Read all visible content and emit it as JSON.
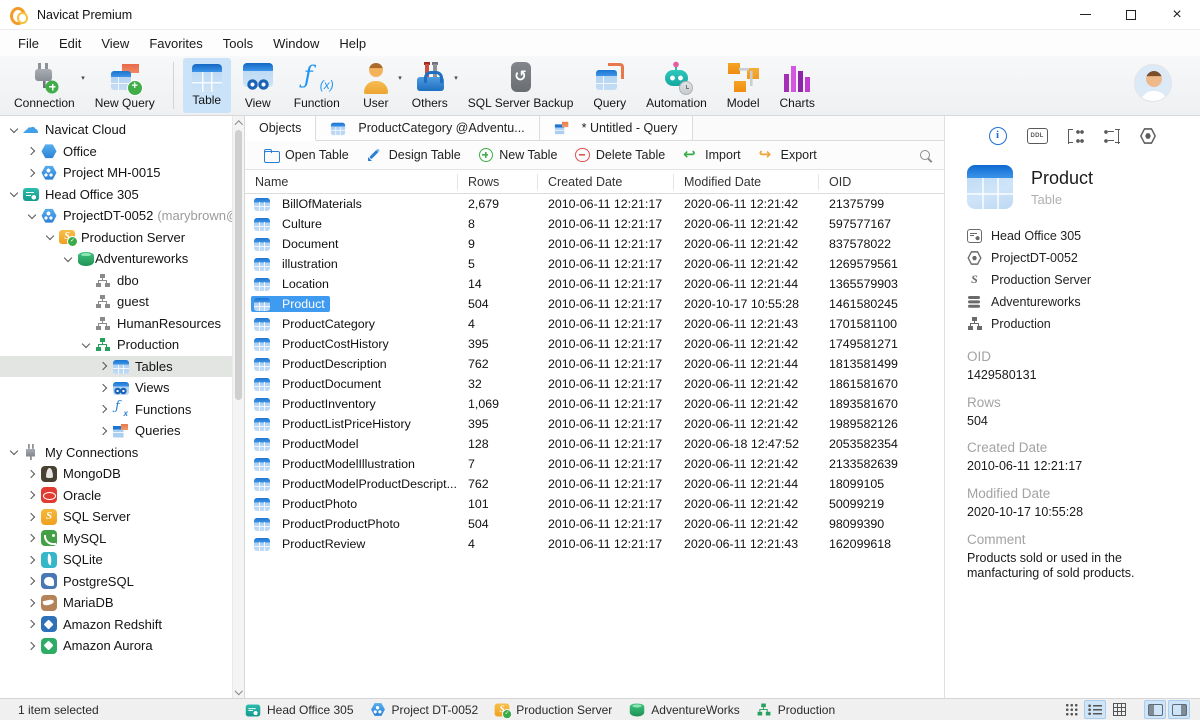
{
  "titlebar": {
    "title": "Navicat Premium",
    "controls": [
      "minimize",
      "maximize",
      "close"
    ]
  },
  "menubar": {
    "items": [
      "File",
      "Edit",
      "View",
      "Favorites",
      "Tools",
      "Window",
      "Help"
    ]
  },
  "toolbar": {
    "buttons": [
      {
        "label": "Connection",
        "icon": "connection",
        "dropdown": true,
        "divider_after": false
      },
      {
        "label": "New Query",
        "icon": "newquery",
        "divider_after": true
      },
      {
        "label": "Table",
        "icon": "table",
        "selected": true
      },
      {
        "label": "View",
        "icon": "view"
      },
      {
        "label": "Function",
        "icon": "function"
      },
      {
        "label": "User",
        "icon": "user",
        "dropdown": true
      },
      {
        "label": "Others",
        "icon": "others",
        "dropdown": true
      },
      {
        "label": "SQL Server Backup",
        "icon": "backup"
      },
      {
        "label": "Query",
        "icon": "query"
      },
      {
        "label": "Automation",
        "icon": "automation"
      },
      {
        "label": "Model",
        "icon": "model"
      },
      {
        "label": "Charts",
        "icon": "charts"
      }
    ]
  },
  "sidebar": {
    "items": [
      {
        "label": "Navicat Cloud",
        "level": 0,
        "chevron": "down",
        "icon": "cloud"
      },
      {
        "label": "Office",
        "level": 1,
        "chevron": "right",
        "icon": "hex"
      },
      {
        "label": "Project MH-0015",
        "level": 1,
        "chevron": "right",
        "icon": "proj"
      },
      {
        "label": "Head Office 305",
        "level": 0,
        "chevron": "down",
        "icon": "ws"
      },
      {
        "label": "ProjectDT-0052",
        "suffix": "(marybrown@",
        "level": 1,
        "chevron": "down",
        "icon": "proj"
      },
      {
        "label": "Production Server",
        "level": 2,
        "chevron": "down",
        "icon": "srv"
      },
      {
        "label": "Adventureworks",
        "level": 3,
        "chevron": "down",
        "icon": "db"
      },
      {
        "label": "dbo",
        "level": 4,
        "chevron": null,
        "icon": "orgg"
      },
      {
        "label": "guest",
        "level": 4,
        "chevron": null,
        "icon": "orgg"
      },
      {
        "label": "HumanResources",
        "level": 4,
        "chevron": null,
        "icon": "orgg"
      },
      {
        "label": "Production",
        "level": 4,
        "chevron": "down",
        "icon": "orggr"
      },
      {
        "label": "Tables",
        "level": 5,
        "chevron": "right",
        "icon": "tbl",
        "selected": true
      },
      {
        "label": "Views",
        "level": 5,
        "chevron": "right",
        "icon": "view"
      },
      {
        "label": "Functions",
        "level": 5,
        "chevron": "right",
        "icon": "fx"
      },
      {
        "label": "Queries",
        "level": 5,
        "chevron": "right",
        "icon": "qry"
      },
      {
        "label": "My Connections",
        "level": 0,
        "chevron": "down",
        "icon": "plug"
      },
      {
        "label": "MongoDB",
        "level": 1,
        "chevron": "right",
        "icon": "mongodb"
      },
      {
        "label": "Oracle",
        "level": 1,
        "chevron": "right",
        "icon": "oracle"
      },
      {
        "label": "SQL Server",
        "level": 1,
        "chevron": "right",
        "icon": "sqlserver"
      },
      {
        "label": "MySQL",
        "level": 1,
        "chevron": "right",
        "icon": "mysql"
      },
      {
        "label": "SQLite",
        "level": 1,
        "chevron": "right",
        "icon": "sqlite"
      },
      {
        "label": "PostgreSQL",
        "level": 1,
        "chevron": "right",
        "icon": "postgresql"
      },
      {
        "label": "MariaDB",
        "level": 1,
        "chevron": "right",
        "icon": "mariadb"
      },
      {
        "label": "Amazon Redshift",
        "level": 1,
        "chevron": "right",
        "icon": "redshift"
      },
      {
        "label": "Amazon Aurora",
        "level": 1,
        "chevron": "right",
        "icon": "aurora"
      }
    ]
  },
  "tabs": [
    {
      "label": "Objects",
      "icon": null,
      "active": true
    },
    {
      "label": "ProductCategory @Adventu...",
      "icon": "tbl"
    },
    {
      "label": "* Untitled - Query",
      "icon": "qry"
    }
  ],
  "object_toolbar": {
    "buttons": [
      {
        "label": "Open Table",
        "icon": "open"
      },
      {
        "label": "Design Table",
        "icon": "design"
      },
      {
        "label": "New Table",
        "icon": "plus"
      },
      {
        "label": "Delete Table",
        "icon": "minus"
      },
      {
        "label": "Import",
        "icon": "import"
      },
      {
        "label": "Export",
        "icon": "export"
      }
    ]
  },
  "objects_table": {
    "columns": [
      "Name",
      "Rows",
      "Created Date",
      "Modified Date",
      "OID"
    ],
    "selected_row": "Product",
    "rows": [
      [
        "BillOfMaterials",
        "2,679",
        "2010-06-11 12:21:17",
        "2020-06-11 12:21:42",
        "21375799"
      ],
      [
        "Culture",
        "8",
        "2010-06-11 12:21:17",
        "2020-06-11 12:21:42",
        "597577167"
      ],
      [
        "Document",
        "9",
        "2010-06-11 12:21:17",
        "2020-06-11 12:21:42",
        "837578022"
      ],
      [
        "illustration",
        "5",
        "2010-06-11 12:21:17",
        "2020-06-11 12:21:42",
        "1269579561"
      ],
      [
        "Location",
        "14",
        "2010-06-11 12:21:17",
        "2020-06-11 12:21:44",
        "1365579903"
      ],
      [
        "Product",
        "504",
        "2010-06-11 12:21:17",
        "2020-10-17 10:55:28",
        "1461580245"
      ],
      [
        "ProductCategory",
        "4",
        "2010-06-11 12:21:17",
        "2020-06-11 12:21:43",
        "1701581100"
      ],
      [
        "ProductCostHistory",
        "395",
        "2010-06-11 12:21:17",
        "2020-06-11 12:21:42",
        "1749581271"
      ],
      [
        "ProductDescription",
        "762",
        "2010-06-11 12:21:17",
        "2020-06-11 12:21:44",
        "1813581499"
      ],
      [
        "ProductDocument",
        "32",
        "2010-06-11 12:21:17",
        "2020-06-11 12:21:42",
        "1861581670"
      ],
      [
        "ProductInventory",
        "1,069",
        "2010-06-11 12:21:17",
        "2020-06-11 12:21:42",
        "1893581670"
      ],
      [
        "ProductListPriceHistory",
        "395",
        "2010-06-11 12:21:17",
        "2020-06-11 12:21:42",
        "1989582126"
      ],
      [
        "ProductModel",
        "128",
        "2010-06-11 12:21:17",
        "2020-06-18 12:47:52",
        "2053582354"
      ],
      [
        "ProductModelIllustration",
        "7",
        "2010-06-11 12:21:17",
        "2020-06-11 12:21:42",
        "2133582639"
      ],
      [
        "ProductModelProductDescript...",
        "762",
        "2010-06-11 12:21:17",
        "2020-06-11 12:21:44",
        "18099105"
      ],
      [
        "ProductPhoto",
        "101",
        "2010-06-11 12:21:17",
        "2020-06-11 12:21:42",
        "50099219"
      ],
      [
        "ProductProductPhoto",
        "504",
        "2010-06-11 12:21:17",
        "2020-06-11 12:21:42",
        "98099390"
      ],
      [
        "ProductReview",
        "4",
        "2010-06-11 12:21:17",
        "2020-06-11 12:21:43",
        "162099618"
      ]
    ]
  },
  "right_panel": {
    "icons": [
      {
        "name": "info",
        "active": true
      },
      {
        "name": "ddl",
        "active": false
      },
      {
        "name": "rel1",
        "active": false
      },
      {
        "name": "rel2",
        "active": false
      },
      {
        "name": "hexx",
        "active": false
      }
    ],
    "title": "Product",
    "subtitle": "Table",
    "crumbs": [
      {
        "label": "Head Office 305",
        "icon": "ws"
      },
      {
        "label": "ProjectDT-0052",
        "icon": "hexo"
      },
      {
        "label": "Production Server",
        "icon": "sqlgray"
      },
      {
        "label": "Adventureworks",
        "icon": "dbo"
      },
      {
        "label": "Production",
        "icon": "org"
      }
    ],
    "fields": [
      {
        "label": "OID",
        "value": "1429580131"
      },
      {
        "label": "Rows",
        "value": "504"
      },
      {
        "label": "Created Date",
        "value": "2010-06-11 12:21:17"
      },
      {
        "label": "Modified Date",
        "value": "2020-10-17 10:55:28"
      },
      {
        "label": "Comment",
        "value": "Products sold or used in the manfacturing of sold products."
      }
    ]
  },
  "statusbar": {
    "left": "1 item selected",
    "crumbs": [
      {
        "label": "Head Office 305",
        "icon": "ws"
      },
      {
        "label": "Project DT-0052",
        "icon": "proj"
      },
      {
        "label": "Production Server",
        "icon": "srv"
      },
      {
        "label": "AdventureWorks",
        "icon": "db"
      },
      {
        "label": "Production",
        "icon": "orggr"
      }
    ],
    "view_icons": [
      {
        "name": "grid",
        "selected": false
      },
      {
        "name": "list",
        "selected": true
      },
      {
        "name": "detail",
        "selected": false
      }
    ],
    "panel_icons": [
      {
        "name": "left-panel",
        "selected": true
      },
      {
        "name": "right-panel",
        "selected": true
      }
    ]
  }
}
